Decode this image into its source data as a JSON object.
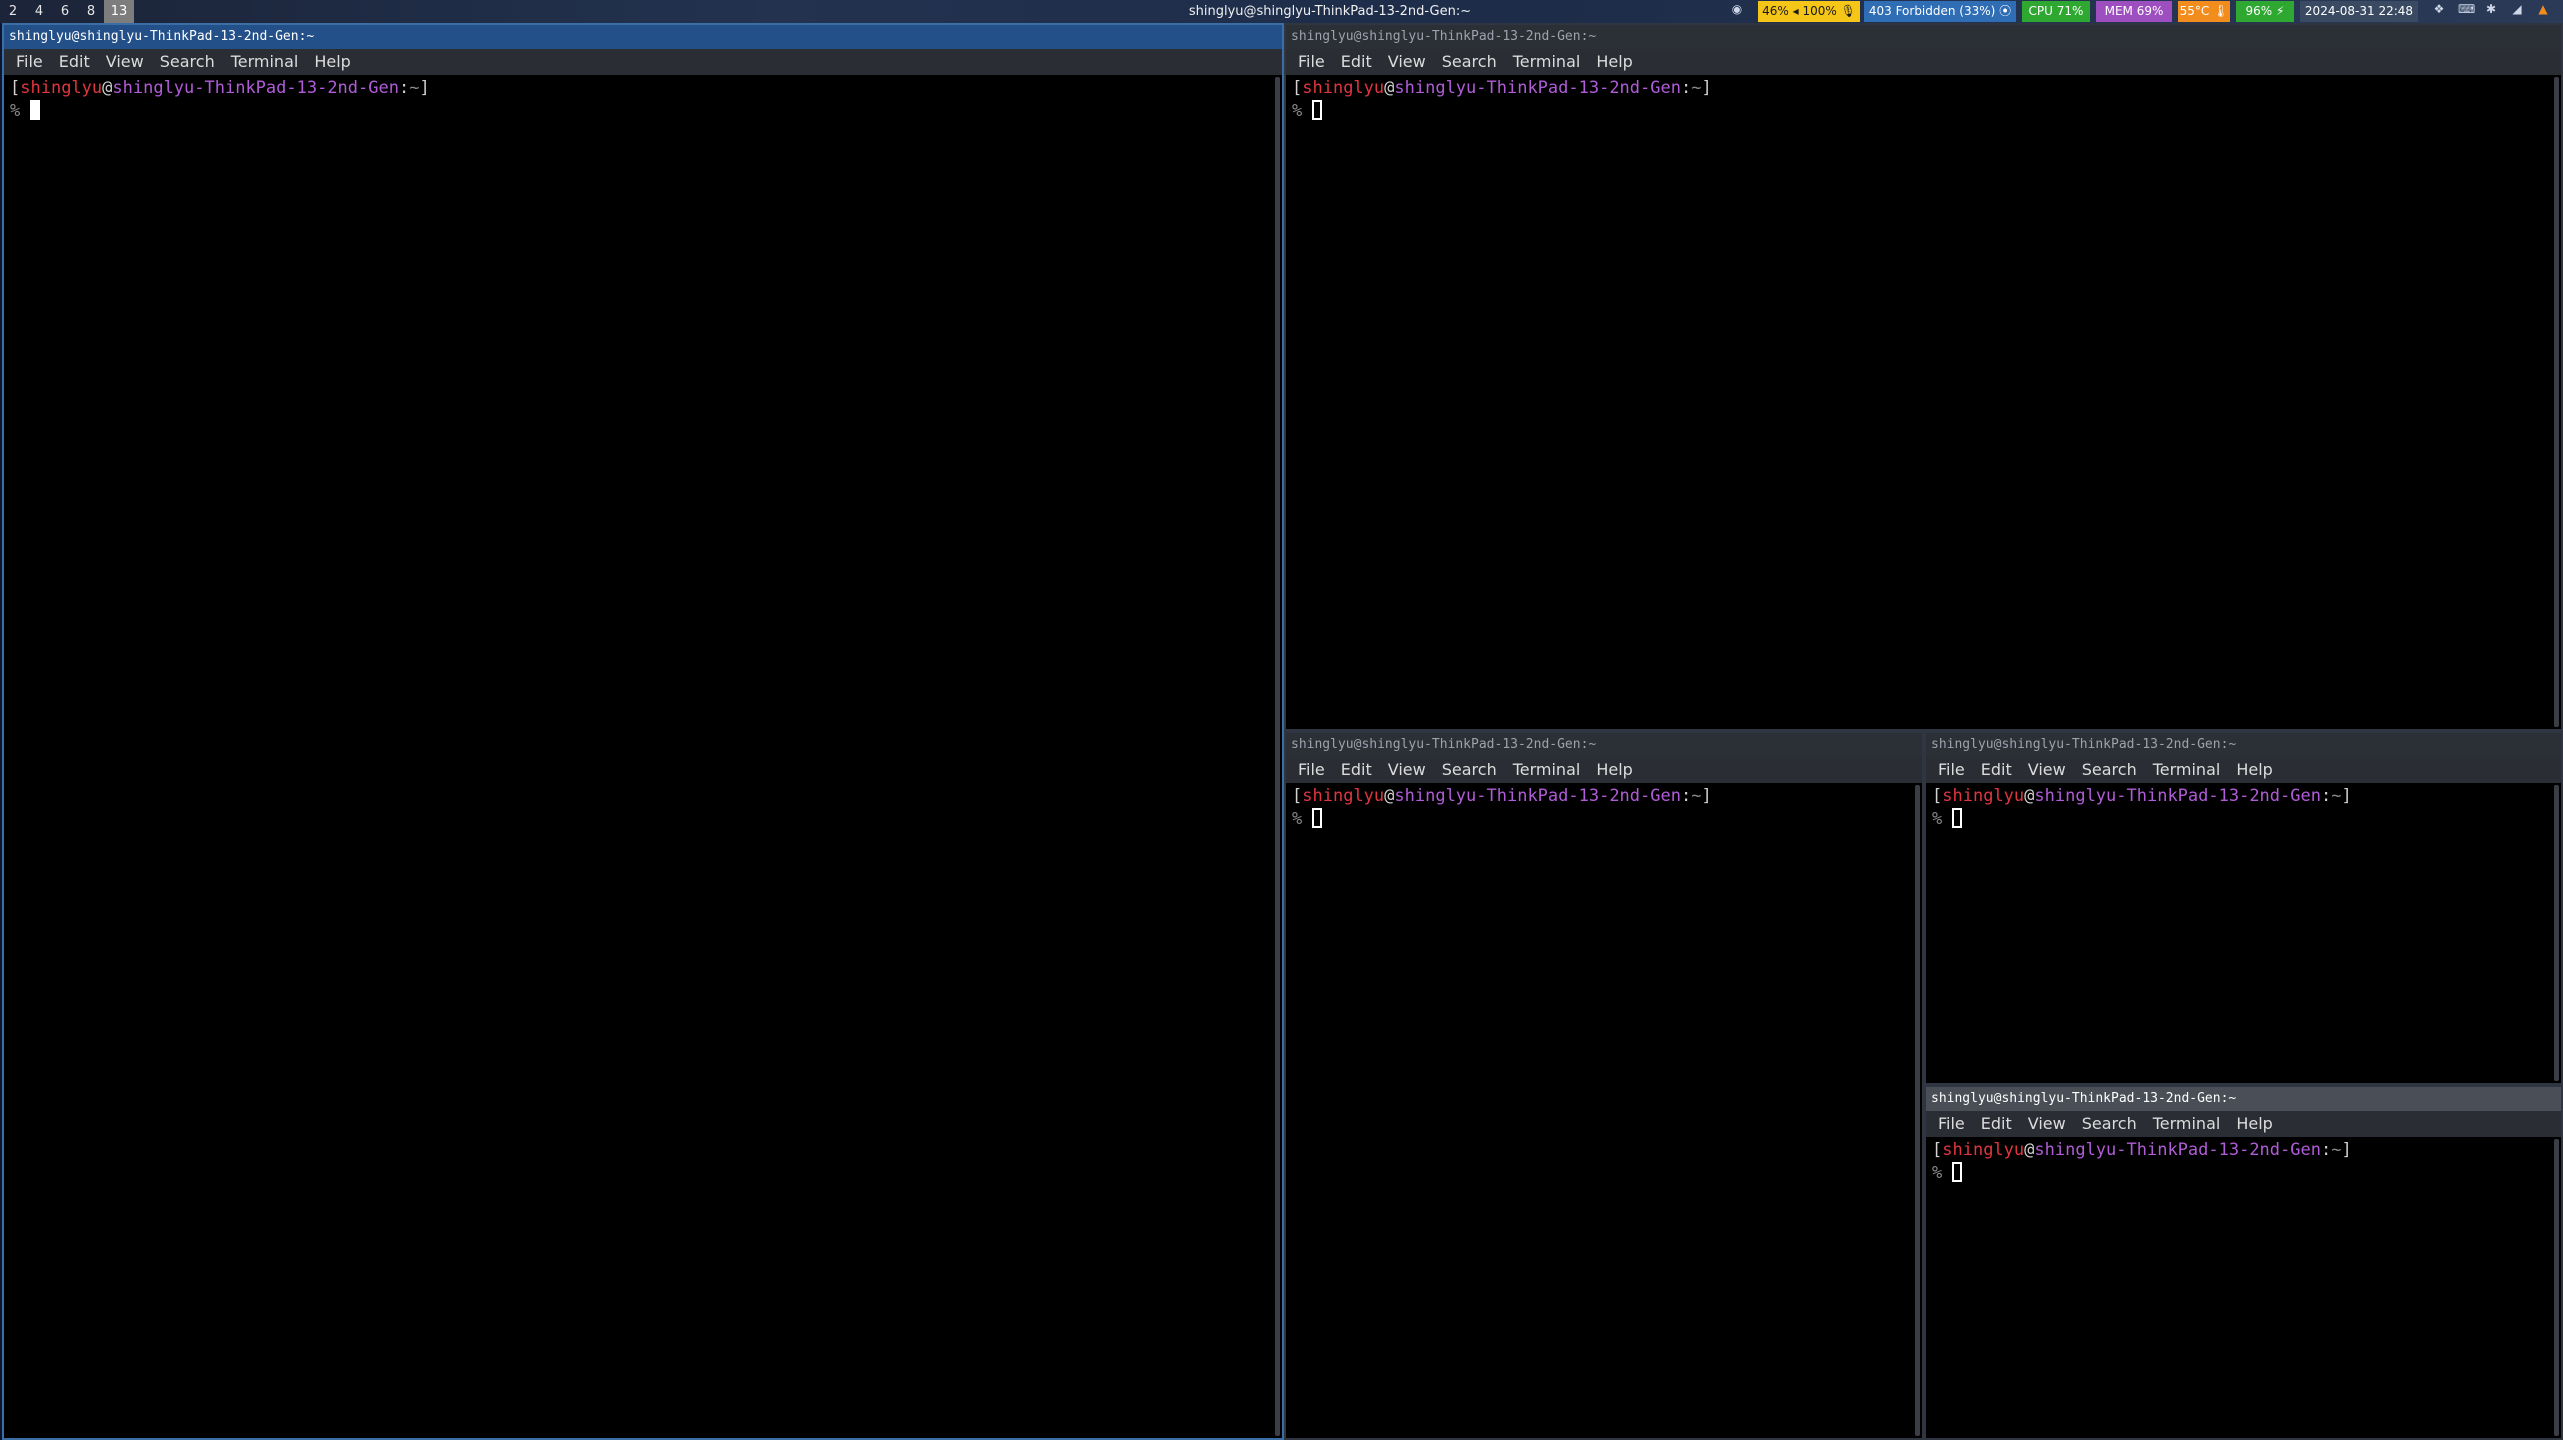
{
  "topbar": {
    "workspaces": [
      "2",
      "4",
      "6",
      "8",
      "13"
    ],
    "active_workspace": "13",
    "window_title": "shinglyu@shinglyu-ThinkPad-13-2nd-Gen:~",
    "status": {
      "volume": "46% ◂ 100% 🎙",
      "wifi": "403 Forbidden (33%) ⦿",
      "cpu": "CPU 71%",
      "mem": "MEM 69%",
      "temp": "55°C 🌡",
      "battery": "96% ⚡",
      "datetime": "2024-08-31  22:48"
    },
    "colors": {
      "volume": "#f5c518",
      "wifi": "#2f6db5",
      "cpu": "#2fa832",
      "mem": "#9d4fbf",
      "temp": "#f28c1c",
      "battery": "#2fa832",
      "datetime": "#3a4a63"
    }
  },
  "terminals": [
    {
      "title": "shinglyu@shinglyu-ThinkPad-13-2nd-Gen:~",
      "menu": [
        "File",
        "Edit",
        "View",
        "Search",
        "Terminal",
        "Help"
      ],
      "prompt": {
        "user": "shinglyu",
        "at": "@",
        "host": "shinglyu-ThinkPad-13-2nd-Gen",
        "colon": ":",
        "path": "~",
        "symbol": "%"
      },
      "focused": true
    },
    {
      "title": "shinglyu@shinglyu-ThinkPad-13-2nd-Gen:~",
      "menu": [
        "File",
        "Edit",
        "View",
        "Search",
        "Terminal",
        "Help"
      ],
      "prompt": {
        "user": "shinglyu",
        "at": "@",
        "host": "shinglyu-ThinkPad-13-2nd-Gen",
        "colon": ":",
        "path": "~",
        "symbol": "%"
      },
      "focused": false
    },
    {
      "title": "shinglyu@shinglyu-ThinkPad-13-2nd-Gen:~",
      "menu": [
        "File",
        "Edit",
        "View",
        "Search",
        "Terminal",
        "Help"
      ],
      "prompt": {
        "user": "shinglyu",
        "at": "@",
        "host": "shinglyu-ThinkPad-13-2nd-Gen",
        "colon": ":",
        "path": "~",
        "symbol": "%"
      },
      "focused": false
    },
    {
      "title": "shinglyu@shinglyu-ThinkPad-13-2nd-Gen:~",
      "menu": [
        "File",
        "Edit",
        "View",
        "Search",
        "Terminal",
        "Help"
      ],
      "prompt": {
        "user": "shinglyu",
        "at": "@",
        "host": "shinglyu-ThinkPad-13-2nd-Gen",
        "colon": ":",
        "path": "~",
        "symbol": "%"
      },
      "focused": false
    },
    {
      "title": "shinglyu@shinglyu-ThinkPad-13-2nd-Gen:~",
      "menu": [
        "File",
        "Edit",
        "View",
        "Search",
        "Terminal",
        "Help"
      ],
      "prompt": {
        "user": "shinglyu",
        "at": "@",
        "host": "shinglyu-ThinkPad-13-2nd-Gen",
        "colon": ":",
        "path": "~",
        "symbol": "%"
      },
      "focused": false
    }
  ]
}
